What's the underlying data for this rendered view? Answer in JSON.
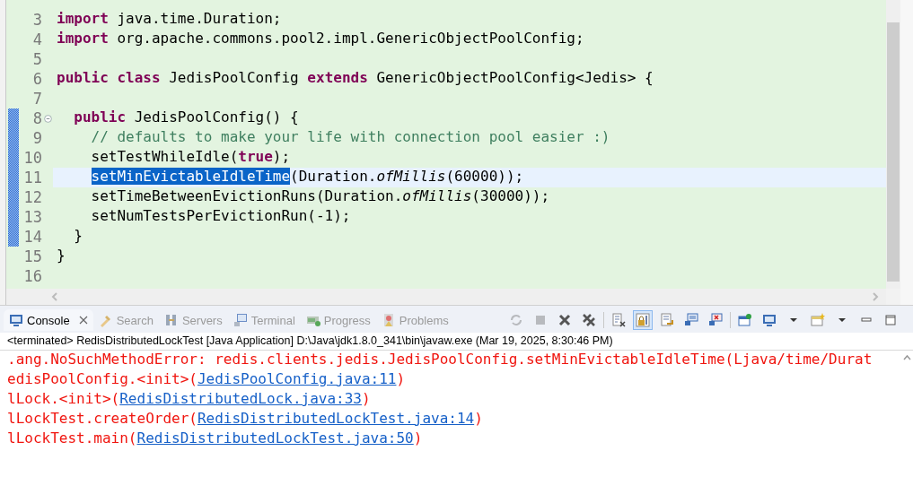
{
  "editor": {
    "lines": [
      {
        "number": "3",
        "changed": false,
        "current": false,
        "foldable": false,
        "tokens": [
          {
            "kind": "keyword",
            "text": "import"
          },
          {
            "kind": "plain",
            "text": " java.time.Duration;"
          }
        ]
      },
      {
        "number": "4",
        "changed": false,
        "current": false,
        "foldable": false,
        "tokens": [
          {
            "kind": "keyword",
            "text": "import"
          },
          {
            "kind": "plain",
            "text": " org.apache.commons.pool2.impl.GenericObjectPoolConfig;"
          }
        ]
      },
      {
        "number": "5",
        "changed": false,
        "current": false,
        "foldable": false
      },
      {
        "number": "6",
        "changed": false,
        "current": false,
        "foldable": false,
        "tokens": [
          {
            "kind": "keyword",
            "text": "public class"
          },
          {
            "kind": "plain",
            "text": " JedisPoolConfig "
          },
          {
            "kind": "keyword",
            "text": "extends"
          },
          {
            "kind": "plain",
            "text": " GenericObjectPoolConfig<Jedis> {"
          }
        ],
        "children": [
          {
            "number": "7",
            "changed": false,
            "current": false,
            "foldable": false
          },
          {
            "number": "8",
            "changed": true,
            "current": false,
            "foldable": true,
            "tokens": [
              {
                "kind": "keyword",
                "text": "public"
              },
              {
                "kind": "plain",
                "text": " JedisPoolConfig() {"
              }
            ],
            "children": [
              {
                "number": "9",
                "changed": true,
                "current": false,
                "foldable": false,
                "tokens": [
                  {
                    "kind": "comment",
                    "text": "// defaults to make your life with connection pool easier :)"
                  }
                ]
              },
              {
                "number": "10",
                "changed": true,
                "current": false,
                "foldable": false,
                "tokens": [
                  {
                    "kind": "plain",
                    "text": "setTestWhileIdle("
                  },
                  {
                    "kind": "keyword",
                    "text": "true"
                  },
                  {
                    "kind": "plain",
                    "text": ");"
                  }
                ]
              },
              {
                "number": "11",
                "changed": true,
                "current": true,
                "foldable": false,
                "tokens": [
                  {
                    "kind": "selection",
                    "text": "setMinEvictableIdleTime"
                  },
                  {
                    "kind": "plain",
                    "text": "(Duration."
                  },
                  {
                    "kind": "static",
                    "text": "ofMillis"
                  },
                  {
                    "kind": "plain",
                    "text": "(60000));"
                  }
                ]
              },
              {
                "number": "12",
                "changed": true,
                "current": false,
                "foldable": false,
                "tokens": [
                  {
                    "kind": "plain",
                    "text": "setTimeBetweenEvictionRuns(Duration."
                  },
                  {
                    "kind": "static",
                    "text": "ofMillis"
                  },
                  {
                    "kind": "plain",
                    "text": "(30000));"
                  }
                ]
              },
              {
                "number": "13",
                "changed": true,
                "current": false,
                "foldable": false,
                "tokens": [
                  {
                    "kind": "plain",
                    "text": "setNumTestsPerEvictionRun(-1);"
                  }
                ]
              }
            ]
          },
          {
            "number": "14",
            "changed": true,
            "current": false,
            "foldable": false,
            "tokens": [
              {
                "kind": "plain",
                "text": "}"
              }
            ]
          }
        ]
      },
      {
        "number": "15",
        "changed": false,
        "current": false,
        "foldable": false,
        "tokens": [
          {
            "kind": "plain",
            "text": "}"
          }
        ]
      },
      {
        "number": "16",
        "changed": false,
        "current": false,
        "foldable": false
      }
    ]
  },
  "console": {
    "tabs": [
      {
        "label": "Console",
        "kind": "console",
        "selected": true
      },
      {
        "label": "Search",
        "kind": "search",
        "selected": false
      },
      {
        "label": "Servers",
        "kind": "servers",
        "selected": false
      },
      {
        "label": "Terminal",
        "kind": "terminal",
        "selected": false
      },
      {
        "label": "Progress",
        "kind": "progress",
        "selected": false
      },
      {
        "label": "Problems",
        "kind": "problems",
        "selected": false
      }
    ],
    "toolbar": [
      {
        "kind": "sync",
        "disabled": true,
        "pressed": false
      },
      {
        "kind": "stop",
        "disabled": true,
        "pressed": false
      },
      {
        "kind": "remove",
        "disabled": false,
        "pressed": false
      },
      {
        "kind": "remove-all",
        "disabled": false,
        "pressed": false
      },
      {
        "kind": "sep"
      },
      {
        "kind": "clear",
        "disabled": false,
        "pressed": false
      },
      {
        "kind": "lock",
        "disabled": false,
        "pressed": true
      },
      {
        "kind": "wrap",
        "disabled": false,
        "pressed": false
      },
      {
        "kind": "show-out",
        "disabled": false,
        "pressed": false
      },
      {
        "kind": "show-err",
        "disabled": false,
        "pressed": false
      },
      {
        "kind": "sep"
      },
      {
        "kind": "pin",
        "disabled": false,
        "pressed": false
      },
      {
        "kind": "display",
        "disabled": false,
        "pressed": false
      },
      {
        "kind": "caret",
        "disabled": false,
        "pressed": false
      },
      {
        "kind": "new",
        "disabled": false,
        "pressed": false
      },
      {
        "kind": "caret",
        "disabled": false,
        "pressed": false
      },
      {
        "kind": "minimize",
        "disabled": false,
        "pressed": false
      },
      {
        "kind": "maximize",
        "disabled": false,
        "pressed": false
      }
    ],
    "status": "<terminated> RedisDistributedLockTest [Java Application] D:\\Java\\jdk1.8.0_341\\bin\\javaw.exe (Mar 19, 2025, 8:30:46 PM)",
    "output": [
      [
        {
          "kind": "error",
          "text": ".ang.NoSuchMethodError: redis.clients.jedis.JedisPoolConfig.setMinEvictableIdleTime(Ljava/time/Durat"
        }
      ],
      [
        {
          "kind": "error",
          "text": "edisPoolConfig.<init>("
        },
        {
          "kind": "link",
          "text": "JedisPoolConfig.java:11"
        },
        {
          "kind": "error",
          "text": ")"
        }
      ],
      [
        {
          "kind": "error",
          "text": "lLock.<init>("
        },
        {
          "kind": "link",
          "text": "RedisDistributedLock.java:33"
        },
        {
          "kind": "error",
          "text": ")"
        }
      ],
      [
        {
          "kind": "error",
          "text": "lLockTest.createOrder("
        },
        {
          "kind": "link",
          "text": "RedisDistributedLockTest.java:14"
        },
        {
          "kind": "error",
          "text": ")"
        }
      ],
      [
        {
          "kind": "error",
          "text": "lLockTest.main("
        },
        {
          "kind": "link",
          "text": "RedisDistributedLockTest.java:50"
        },
        {
          "kind": "error",
          "text": ")"
        }
      ]
    ]
  }
}
